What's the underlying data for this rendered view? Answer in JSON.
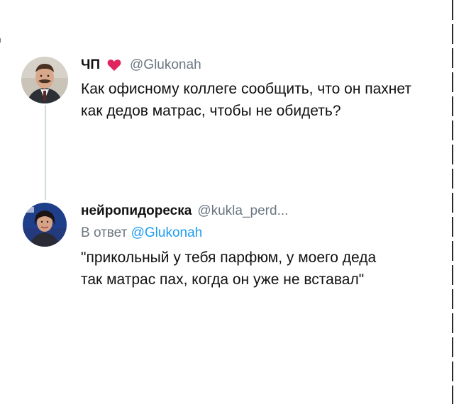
{
  "colors": {
    "background": "#ffffff",
    "text": "#111111",
    "muted": "#6b7680",
    "link": "#1d9bf0",
    "heart": "#e0245e",
    "thread_line": "#cfd9de"
  },
  "tweets": [
    {
      "author_name": "ЧП",
      "emoji_icon": "heart-emoji",
      "handle": "@Glukonah",
      "text": "Как офисному коллеге сообщить, что он пахнет как дедов матрас, чтобы не обидеть?"
    },
    {
      "author_name": "нейропидореска",
      "handle": "@kukla_perd...",
      "reply_prefix": "В ответ",
      "reply_mention": "@Glukonah",
      "text": "\"прикольный у тебя парфюм, у моего деда так матрас пах, когда он уже не вставал\""
    }
  ]
}
